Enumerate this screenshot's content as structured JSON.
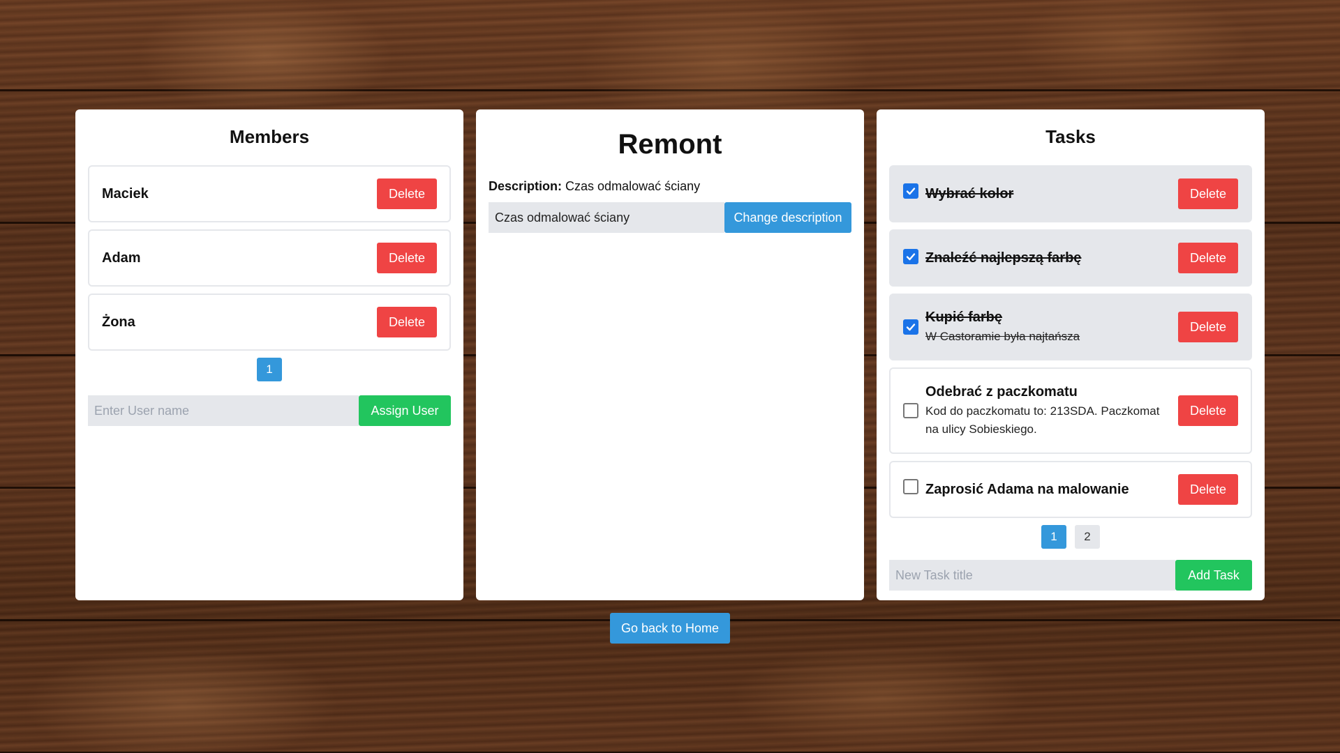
{
  "members": {
    "title": "Members",
    "items": [
      {
        "name": "Maciek",
        "delete_label": "Delete"
      },
      {
        "name": "Adam",
        "delete_label": "Delete"
      },
      {
        "name": "Żona",
        "delete_label": "Delete"
      }
    ],
    "pages": [
      "1"
    ],
    "current_page": "1",
    "input_placeholder": "Enter User name",
    "input_value": "",
    "assign_label": "Assign User"
  },
  "project": {
    "title": "Remont",
    "description_label": "Description:",
    "description": "Czas odmalować ściany",
    "input_value": "Czas odmalować ściany",
    "change_label": "Change description"
  },
  "tasks": {
    "title": "Tasks",
    "items": [
      {
        "title": "Wybrać kolor",
        "description": "",
        "done": true,
        "delete_label": "Delete"
      },
      {
        "title": "Znaleźć najlepszą farbę",
        "description": "",
        "done": true,
        "delete_label": "Delete"
      },
      {
        "title": "Kupić farbę",
        "description": "W Castoramie była najtańsza",
        "done": true,
        "delete_label": "Delete"
      },
      {
        "title": "Odebrać z paczkomatu",
        "description": "Kod do paczkomatu to: 213SDA. Paczkomat na ulicy Sobieskiego.",
        "done": false,
        "delete_label": "Delete"
      },
      {
        "title": "Zaprosić Adama na malowanie",
        "description": "",
        "done": false,
        "delete_label": "Delete"
      }
    ],
    "pages": [
      "1",
      "2"
    ],
    "current_page": "1",
    "input_placeholder": "New Task title",
    "input_value": "",
    "add_label": "Add Task"
  },
  "navigation": {
    "home_label": "Go back to Home"
  },
  "colors": {
    "delete": "#ef4444",
    "primary": "#3498db",
    "success": "#22c55e",
    "checkbox": "#1a73e8"
  }
}
